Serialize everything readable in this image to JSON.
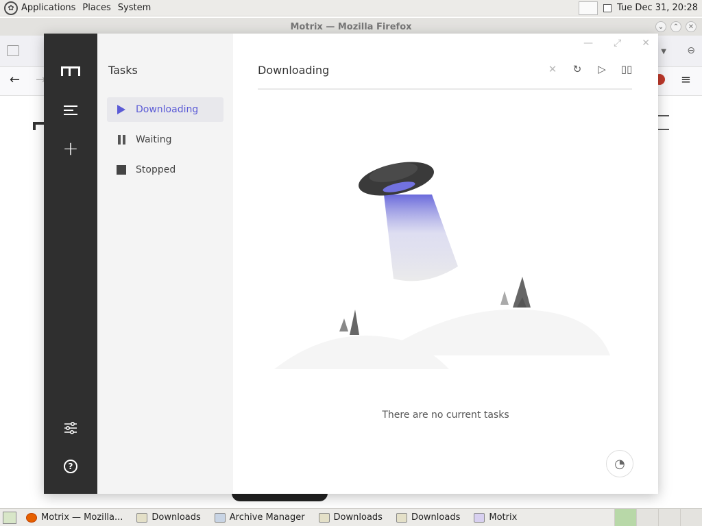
{
  "top_panel": {
    "menus": [
      "Applications",
      "Places",
      "System"
    ],
    "clock": "Tue Dec 31, 20:28"
  },
  "firefox": {
    "title": "Motrix — Mozilla Firefox"
  },
  "motrix": {
    "section_title": "Tasks",
    "nav": [
      {
        "label": "Downloading",
        "icon": "play-icon",
        "active": true
      },
      {
        "label": "Waiting",
        "icon": "pause-icon",
        "active": false
      },
      {
        "label": "Stopped",
        "icon": "stop-icon",
        "active": false
      }
    ],
    "header_title": "Downloading",
    "empty_message": "There are no current tasks",
    "accent_color": "#5b5bd6"
  },
  "taskbar": {
    "tasks": [
      {
        "label": "Motrix — Mozilla...",
        "icon": "firefox-icon"
      },
      {
        "label": "Downloads",
        "icon": "folder-icon"
      },
      {
        "label": "Archive Manager",
        "icon": "archive-icon"
      },
      {
        "label": "Downloads",
        "icon": "folder-icon"
      },
      {
        "label": "Downloads",
        "icon": "folder-icon"
      },
      {
        "label": "Motrix",
        "icon": "motrix-icon"
      }
    ]
  }
}
